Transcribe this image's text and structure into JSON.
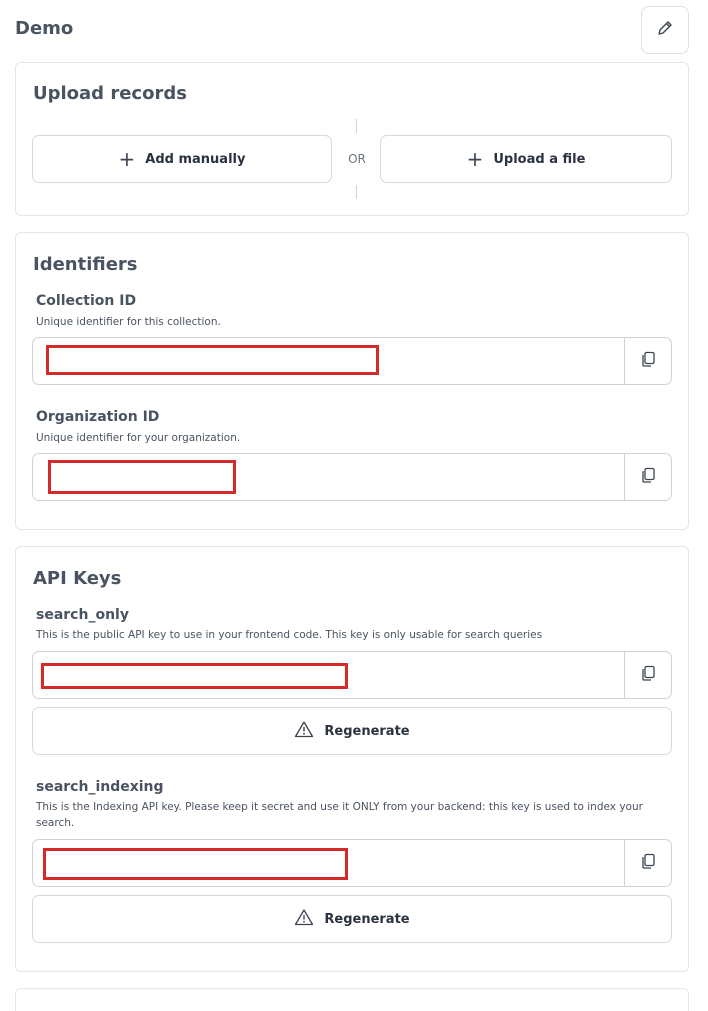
{
  "page": {
    "title": "Demo"
  },
  "upload": {
    "title": "Upload records",
    "add_manually": "Add manually",
    "or": "OR",
    "upload_file": "Upload a file"
  },
  "identifiers": {
    "title": "Identifiers",
    "collection_id": {
      "label": "Collection ID",
      "description": "Unique identifier for this collection."
    },
    "organization_id": {
      "label": "Organization ID",
      "description": "Unique identifier for your organization."
    }
  },
  "api_keys": {
    "title": "API Keys",
    "search_only": {
      "label": "search_only",
      "description": "This is the public API key to use in your frontend code. This key is only usable for search queries",
      "regenerate": "Regenerate"
    },
    "search_indexing": {
      "label": "search_indexing",
      "description": "This is the Indexing API key. Please keep it secret and use it ONLY from your backend: this key is used to index your search.",
      "regenerate": "Regenerate"
    }
  },
  "colors": {
    "redaction": "#d42a2a",
    "border": "#cfd3d8",
    "text": "#4a5361"
  },
  "icons": [
    "pencil-icon",
    "plus-icon",
    "copy-icon",
    "warning-icon"
  ]
}
